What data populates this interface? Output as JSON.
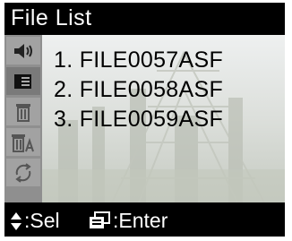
{
  "title": "File List",
  "sidebar": {
    "items": [
      {
        "icon": "speaker-icon",
        "active": false
      },
      {
        "icon": "file-list-icon",
        "active": true
      },
      {
        "icon": "delete-icon",
        "active": false
      },
      {
        "icon": "delete-all-icon",
        "active": false
      },
      {
        "icon": "repeat-icon",
        "active": false
      }
    ]
  },
  "files": [
    {
      "label": "1. FILE0057ASF"
    },
    {
      "label": "2. FILE0058ASF"
    },
    {
      "label": "3. FILE0059ASF"
    }
  ],
  "hint": {
    "select_label": ":Sel",
    "enter_label": ":Enter"
  }
}
